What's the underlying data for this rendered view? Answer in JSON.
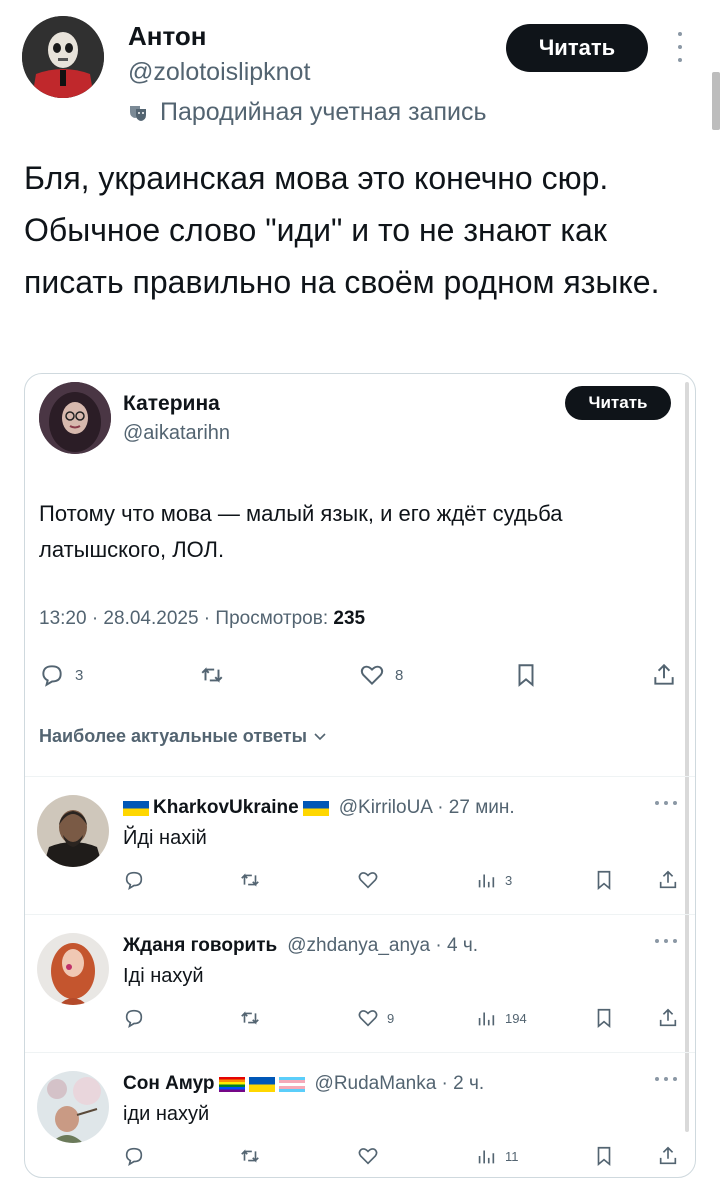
{
  "post": {
    "author_name": "Антон",
    "author_handle": "@zolotoislipknot",
    "parody_label": "Пародийная учетная запись",
    "follow_label": "Читать",
    "text": "Бля, украинская мова это конечно сюр. Обычное слово \"иди\" и то не знают как писать правильно на своём родном языке."
  },
  "quote": {
    "author_name": "Катерина",
    "author_handle": "@aikatarihn",
    "follow_label": "Читать",
    "text": "Потому что мова — малый язык, и его ждёт судьба латышского, ЛОЛ.",
    "meta_prefix": "13:20 · 28.04.2025 · Просмотров: ",
    "views": "235",
    "actions": {
      "replies": "3",
      "likes": "8"
    },
    "sort_label": "Наиболее актуальные ответы",
    "replies": [
      {
        "name": "KharkovUkraine",
        "handle": "@KirriloUA · 27 мин.",
        "text": "Йді нахій",
        "views": "3",
        "likes": ""
      },
      {
        "name": "Жданя говорить",
        "handle": "@zhdanya_anya · 4 ч.",
        "text": "Іді нахуй",
        "views": "194",
        "likes": "9"
      },
      {
        "name": "Сон Амур",
        "handle": "@RudaManka · 2 ч.",
        "text": "іди нахуй",
        "views": "11",
        "likes": ""
      }
    ]
  },
  "colors": {
    "text": "#0f1419",
    "muted": "#536471",
    "button": "#0f1419",
    "border": "#cfd9de",
    "ua_blue": "#0057b7",
    "ua_yellow": "#ffd700"
  }
}
